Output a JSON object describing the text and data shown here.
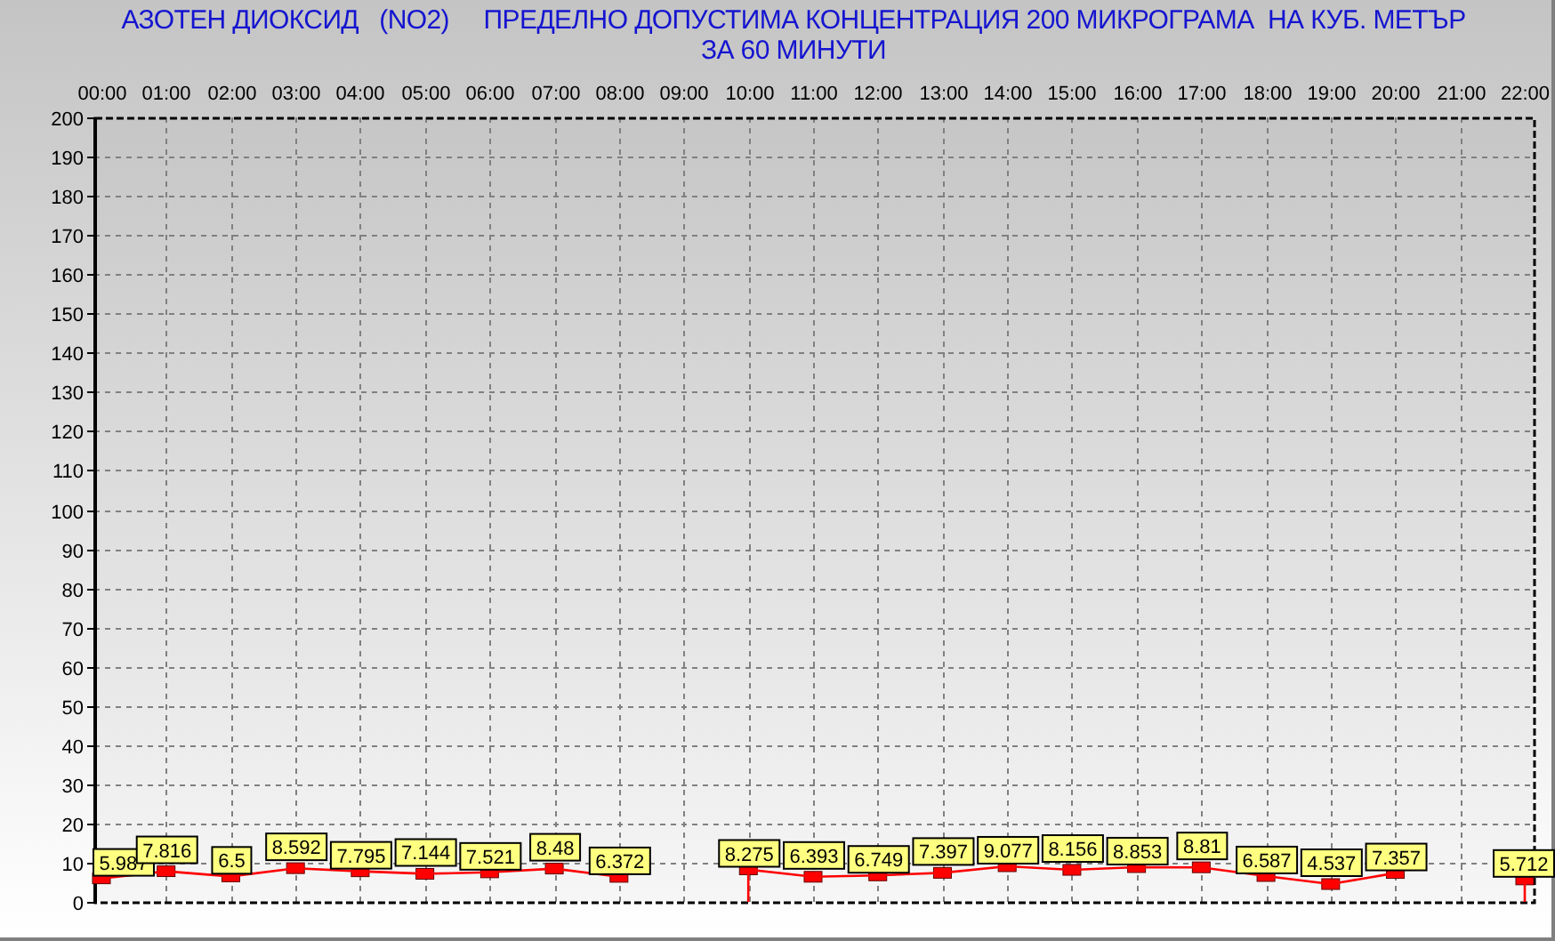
{
  "title_lines": [
    "АЗОТЕН ДИОКСИД   (NO2)     ПРЕДЕЛНО ДОПУСТИМА КОНЦЕНТРАЦИЯ 200 МИКРОГРАМА  НА КУБ. МЕТЪР",
    "ЗА 60 МИНУТИ"
  ],
  "chart_data": {
    "type": "line",
    "categories": [
      "00:00",
      "01:00",
      "02:00",
      "03:00",
      "04:00",
      "05:00",
      "06:00",
      "07:00",
      "08:00",
      "09:00",
      "10:00",
      "11:00",
      "12:00",
      "13:00",
      "14:00",
      "15:00",
      "16:00",
      "17:00",
      "18:00",
      "19:00",
      "20:00",
      "21:00",
      "22:00"
    ],
    "series": [
      {
        "color": "#ff0000",
        "marker": "square",
        "values": [
          5.987,
          7.816,
          6.5,
          8.592,
          7.795,
          7.144,
          7.521,
          8.48,
          6.372,
          null,
          8.275,
          6.393,
          6.749,
          7.397,
          9.077,
          8.156,
          8.853,
          8.81,
          6.587,
          4.537,
          7.357,
          null,
          5.712
        ]
      }
    ],
    "ylim": [
      0,
      200
    ],
    "yticks": [
      0,
      10,
      20,
      30,
      40,
      50,
      60,
      70,
      80,
      90,
      100,
      110,
      120,
      130,
      140,
      150,
      160,
      170,
      180,
      190,
      200
    ],
    "data_labels": true,
    "grid": true
  }
}
